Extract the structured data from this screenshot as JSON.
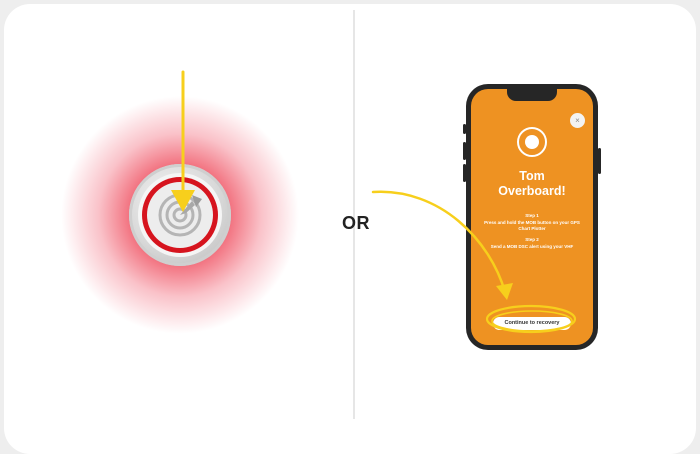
{
  "divider_label": "OR",
  "mob_button": {
    "icon": "target-icon"
  },
  "phone": {
    "close_icon": "×",
    "app_icon": "watch-icon",
    "title_line1": "Tom",
    "title_line2": "Overboard!",
    "step1_heading": "Step 1",
    "step1_text": "Press and hold the MOB button on your GPS Chart Plotter",
    "step2_heading": "Step 2",
    "step2_text": "Send a MOB DSC alert using your VHF",
    "cta_label": "Continue to recovery"
  },
  "colors": {
    "accent_orange": "#ee9222",
    "alert_red": "#d6141e",
    "arrow_yellow": "#f7cf1c",
    "phone_frame": "#262626"
  }
}
